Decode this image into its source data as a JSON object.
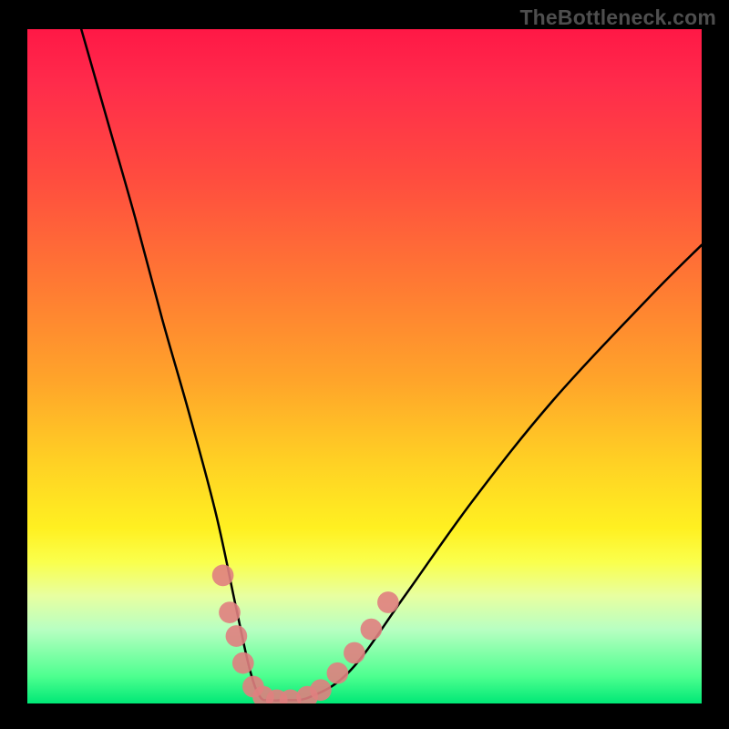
{
  "watermark": "TheBottleneck.com",
  "chart_data": {
    "type": "line",
    "title": "",
    "xlabel": "",
    "ylabel": "",
    "xlim": [
      0,
      100
    ],
    "ylim": [
      0,
      100
    ],
    "grid": false,
    "series": [
      {
        "name": "curve",
        "x": [
          8,
          12,
          16,
          20,
          24,
          28,
          31,
          33,
          34.5,
          36,
          38,
          42,
          48,
          56,
          66,
          78,
          92,
          100
        ],
        "y": [
          100,
          86,
          72,
          57,
          43,
          28,
          14,
          5,
          1,
          0.5,
          0.5,
          1,
          5,
          16,
          30,
          45,
          60,
          68
        ],
        "color": "#000000"
      }
    ],
    "markers": [
      {
        "x": 29.0,
        "y": 19.0,
        "r": 1.6,
        "color": "#e08080"
      },
      {
        "x": 30.0,
        "y": 13.5,
        "r": 1.6,
        "color": "#e08080"
      },
      {
        "x": 31.0,
        "y": 10.0,
        "r": 1.6,
        "color": "#e08080"
      },
      {
        "x": 32.0,
        "y": 6.0,
        "r": 1.6,
        "color": "#e08080"
      },
      {
        "x": 33.5,
        "y": 2.5,
        "r": 1.6,
        "color": "#e08080"
      },
      {
        "x": 35.0,
        "y": 1.0,
        "r": 1.6,
        "color": "#e08080"
      },
      {
        "x": 37.0,
        "y": 0.5,
        "r": 1.6,
        "color": "#e08080"
      },
      {
        "x": 39.0,
        "y": 0.5,
        "r": 1.6,
        "color": "#e08080"
      },
      {
        "x": 41.5,
        "y": 1.0,
        "r": 1.6,
        "color": "#e08080"
      },
      {
        "x": 43.5,
        "y": 2.0,
        "r": 1.6,
        "color": "#e08080"
      },
      {
        "x": 46.0,
        "y": 4.5,
        "r": 1.6,
        "color": "#e08080"
      },
      {
        "x": 48.5,
        "y": 7.5,
        "r": 1.6,
        "color": "#e08080"
      },
      {
        "x": 51.0,
        "y": 11.0,
        "r": 1.6,
        "color": "#e08080"
      },
      {
        "x": 53.5,
        "y": 15.0,
        "r": 1.6,
        "color": "#e08080"
      }
    ],
    "gradient_stops": [
      {
        "pos": 0.0,
        "color": "#ff1846"
      },
      {
        "pos": 0.08,
        "color": "#ff2b4b"
      },
      {
        "pos": 0.22,
        "color": "#ff4c3f"
      },
      {
        "pos": 0.38,
        "color": "#ff7a33"
      },
      {
        "pos": 0.52,
        "color": "#ffa42a"
      },
      {
        "pos": 0.64,
        "color": "#ffd024"
      },
      {
        "pos": 0.74,
        "color": "#fff021"
      },
      {
        "pos": 0.79,
        "color": "#faff4c"
      },
      {
        "pos": 0.84,
        "color": "#e8ffa0"
      },
      {
        "pos": 0.89,
        "color": "#b8ffc2"
      },
      {
        "pos": 0.96,
        "color": "#4dff8f"
      },
      {
        "pos": 1.0,
        "color": "#00e876"
      }
    ]
  }
}
